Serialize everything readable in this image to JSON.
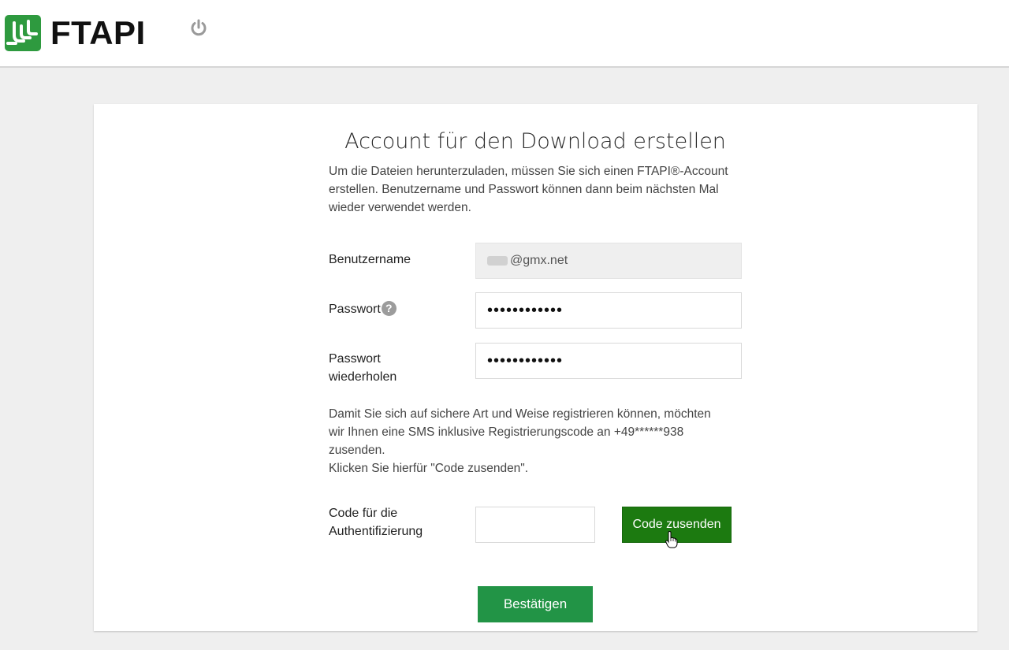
{
  "header": {
    "logo_text": "FTAPI",
    "logout_icon": "power-icon"
  },
  "form": {
    "title": "Account für den Download erstellen",
    "intro_line1": "Um die Dateien herunterzuladen, müssen Sie sich einen FTAPI®-Account",
    "intro_line2": "erstellen. Benutzername und Passwort können dann beim nächsten Mal",
    "intro_line3": "wieder verwendet werden.",
    "username_label": "Benutzername",
    "username_value": "@gmx.net",
    "password_label": "Passwort",
    "password_help": "?",
    "password_value": "••••••••••••",
    "password_repeat_label_1": "Passwort",
    "password_repeat_label_2": "wiederholen",
    "password_repeat_value": "••••••••••••",
    "sms_line1": "Damit Sie sich auf sichere Art und Weise registrieren können, möchten",
    "sms_line2": "wir Ihnen eine SMS inklusive Registrierungscode an +49******938",
    "sms_line3": "zusenden.",
    "sms_line4": "Klicken Sie hierfür \"Code zusenden\".",
    "code_label_1": "Code für die",
    "code_label_2": "Authentifizierung",
    "code_value": "",
    "send_code_button": "Code zusenden",
    "confirm_button": "Bestätigen"
  },
  "colors": {
    "brand_green": "#2e9a3f",
    "send_button": "#1c7a10",
    "confirm_button": "#229446"
  }
}
